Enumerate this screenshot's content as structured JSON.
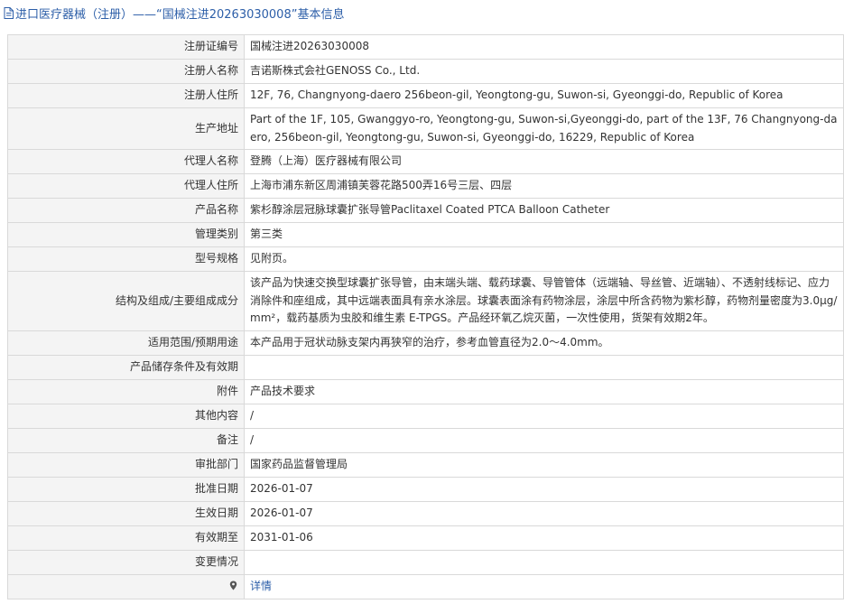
{
  "header": {
    "prefix": "进口医疗器械（注册）——“国械注进20263030008”基本信息"
  },
  "rows": [
    {
      "label": "注册证编号",
      "value": "国械注进20263030008"
    },
    {
      "label": "注册人名称",
      "value": "吉诺斯株式会社GENOSS Co., Ltd."
    },
    {
      "label": "注册人住所",
      "value": "12F, 76, Changnyong-daero 256beon-gil, Yeongtong-gu, Suwon-si, Gyeonggi-do, Republic of Korea"
    },
    {
      "label": "生产地址",
      "value": "Part of the 1F, 105, Gwanggyo-ro, Yeongtong-gu, Suwon-si,Gyeonggi-do, part of the 13F, 76 Changnyong-daero, 256beon-gil, Yeongtong-gu, Suwon-si, Gyeonggi-do, 16229, Republic of Korea"
    },
    {
      "label": "代理人名称",
      "value": "登腾（上海）医疗器械有限公司"
    },
    {
      "label": "代理人住所",
      "value": "上海市浦东新区周浦镇芙蓉花路500弄16号三层、四层"
    },
    {
      "label": "产品名称",
      "value": "紫杉醇涂层冠脉球囊扩张导管Paclitaxel Coated PTCA Balloon Catheter"
    },
    {
      "label": "管理类别",
      "value": "第三类"
    },
    {
      "label": "型号规格",
      "value": "见附页。"
    },
    {
      "label": "结构及组成/主要组成成分",
      "value": "该产品为快速交换型球囊扩张导管，由末端头端、载药球囊、导管管体（远端轴、导丝管、近端轴）、不透射线标记、应力消除件和座组成，其中远端表面具有亲水涂层。球囊表面涂有药物涂层，涂层中所含药物为紫杉醇，药物剂量密度为3.0μg/mm²，载药基质为虫胶和维生素 E-TPGS。产品经环氧乙烷灭菌，一次性使用，货架有效期2年。"
    },
    {
      "label": "适用范围/预期用途",
      "value": "本产品用于冠状动脉支架内再狭窄的治疗，参考血管直径为2.0～4.0mm。"
    },
    {
      "label": "产品储存条件及有效期",
      "value": ""
    },
    {
      "label": "附件",
      "value": "产品技术要求"
    },
    {
      "label": "其他内容",
      "value": "/"
    },
    {
      "label": "备注",
      "value": "/"
    },
    {
      "label": "审批部门",
      "value": "国家药品监督管理局"
    },
    {
      "label": "批准日期",
      "value": "2026-01-07"
    },
    {
      "label": "生效日期",
      "value": "2026-01-07"
    },
    {
      "label": "有效期至",
      "value": "2031-01-06"
    },
    {
      "label": "变更情况",
      "value": ""
    }
  ],
  "detail_row": {
    "icon": "map-pin-icon",
    "link_label": "详情"
  },
  "colors": {
    "header_text": "#2c5ea8",
    "link": "#2c5ea8",
    "label_background": "#f4f4f4",
    "border": "#d9d9d9"
  }
}
